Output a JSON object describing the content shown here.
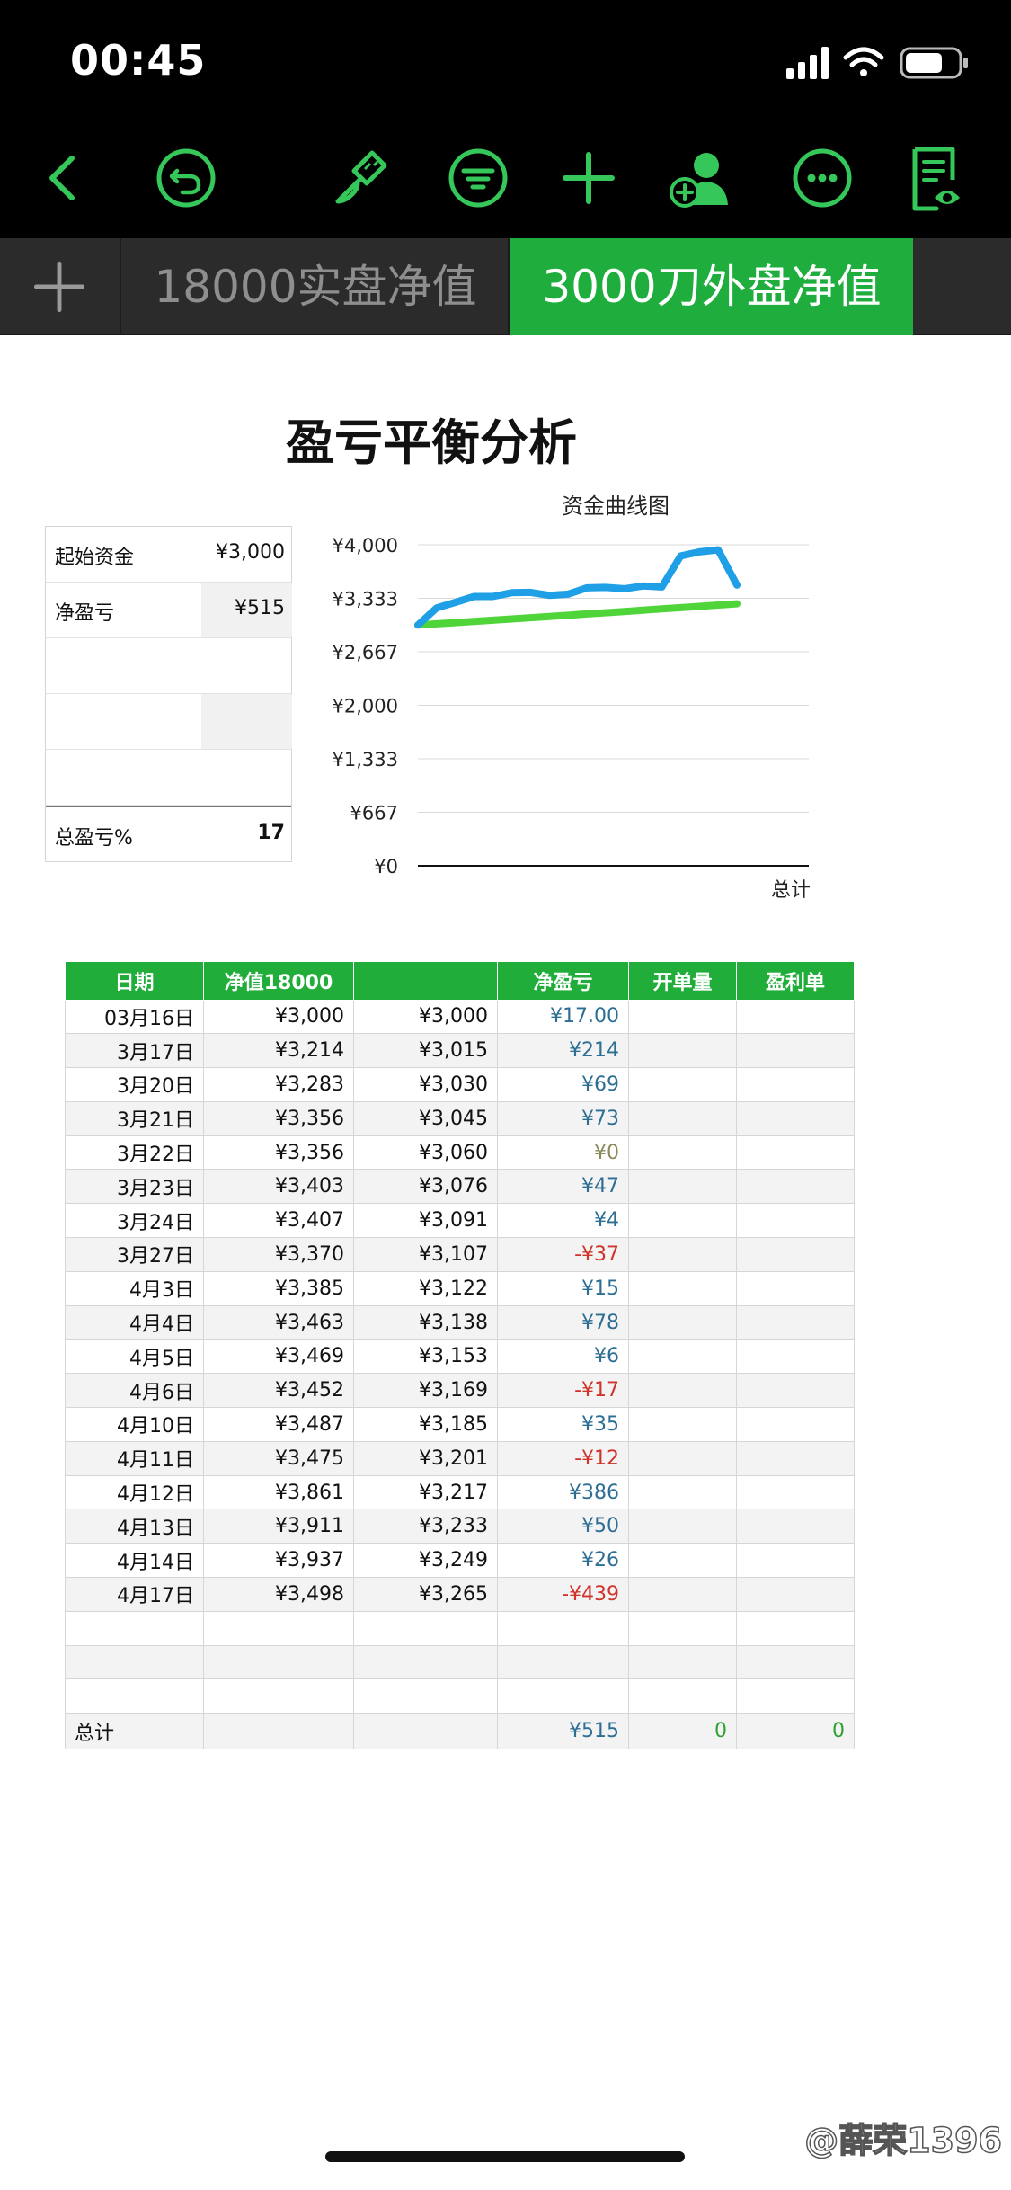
{
  "status": {
    "time": "00:45"
  },
  "toolbar": {
    "icons": [
      "back-icon",
      "undo-icon",
      "paintbrush-icon",
      "filter-icon",
      "add-icon",
      "collaborate-icon",
      "more-icon",
      "reader-view-icon"
    ],
    "accent": "#35c759"
  },
  "tabs": [
    {
      "label": "18000实盘净值",
      "active": false
    },
    {
      "label": "3000刀外盘净值",
      "active": true
    }
  ],
  "sheet": {
    "title": "盈亏平衡分析"
  },
  "summary": {
    "rows": [
      {
        "label": "起始资金",
        "value": "¥3,000"
      },
      {
        "label": "净盈亏",
        "value": "¥515"
      },
      {
        "label": "",
        "value": ""
      },
      {
        "label": "",
        "value": ""
      },
      {
        "label": "",
        "value": ""
      }
    ],
    "total_label": "总盈亏%",
    "total_value": "17"
  },
  "chart_data": {
    "type": "line",
    "title": "资金曲线图",
    "xlabel": "总计",
    "ylabel": "",
    "ylim": [
      0,
      4000
    ],
    "yticks": [
      "¥4,000",
      "¥3,333",
      "¥2,667",
      "¥2,000",
      "¥1,333",
      "¥667",
      "¥0"
    ],
    "ytick_values": [
      4000,
      3333,
      2667,
      2000,
      1333,
      667,
      0
    ],
    "grid": true,
    "series": [
      {
        "color": "#1e9fe6",
        "values": [
          3000,
          3214,
          3283,
          3356,
          3356,
          3403,
          3407,
          3370,
          3385,
          3463,
          3469,
          3452,
          3487,
          3475,
          3861,
          3911,
          3937,
          3498
        ]
      },
      {
        "color": "#4fd43a",
        "values": [
          3000,
          3015,
          3030,
          3045,
          3060,
          3076,
          3091,
          3107,
          3122,
          3138,
          3153,
          3169,
          3185,
          3201,
          3217,
          3233,
          3249,
          3265
        ]
      }
    ]
  },
  "table": {
    "headers": [
      "日期",
      "净值18000",
      "",
      "净盈亏",
      "开单量",
      "盈利单"
    ],
    "rows": [
      [
        "03月16日",
        "¥3,000",
        "¥3,000",
        "¥17.00",
        "",
        ""
      ],
      [
        "3月17日",
        "¥3,214",
        "¥3,015",
        "¥214",
        "",
        ""
      ],
      [
        "3月20日",
        "¥3,283",
        "¥3,030",
        "¥69",
        "",
        ""
      ],
      [
        "3月21日",
        "¥3,356",
        "¥3,045",
        "¥73",
        "",
        ""
      ],
      [
        "3月22日",
        "¥3,356",
        "¥3,060",
        "¥0",
        "",
        ""
      ],
      [
        "3月23日",
        "¥3,403",
        "¥3,076",
        "¥47",
        "",
        ""
      ],
      [
        "3月24日",
        "¥3,407",
        "¥3,091",
        "¥4",
        "",
        ""
      ],
      [
        "3月27日",
        "¥3,370",
        "¥3,107",
        "-¥37",
        "",
        ""
      ],
      [
        "4月3日",
        "¥3,385",
        "¥3,122",
        "¥15",
        "",
        ""
      ],
      [
        "4月4日",
        "¥3,463",
        "¥3,138",
        "¥78",
        "",
        ""
      ],
      [
        "4月5日",
        "¥3,469",
        "¥3,153",
        "¥6",
        "",
        ""
      ],
      [
        "4月6日",
        "¥3,452",
        "¥3,169",
        "-¥17",
        "",
        ""
      ],
      [
        "4月10日",
        "¥3,487",
        "¥3,185",
        "¥35",
        "",
        ""
      ],
      [
        "4月11日",
        "¥3,475",
        "¥3,201",
        "-¥12",
        "",
        ""
      ],
      [
        "4月12日",
        "¥3,861",
        "¥3,217",
        "¥386",
        "",
        ""
      ],
      [
        "4月13日",
        "¥3,911",
        "¥3,233",
        "¥50",
        "",
        ""
      ],
      [
        "4月14日",
        "¥3,937",
        "¥3,249",
        "¥26",
        "",
        ""
      ],
      [
        "4月17日",
        "¥3,498",
        "¥3,265",
        "-¥439",
        "",
        ""
      ],
      [
        "",
        "",
        "",
        "",
        "",
        ""
      ],
      [
        "",
        "",
        "",
        "",
        "",
        ""
      ],
      [
        "",
        "",
        "",
        "",
        "",
        ""
      ]
    ],
    "total": [
      "总计",
      "",
      "",
      "¥515",
      "0",
      "0"
    ]
  },
  "watermark": "@薛荣1396"
}
